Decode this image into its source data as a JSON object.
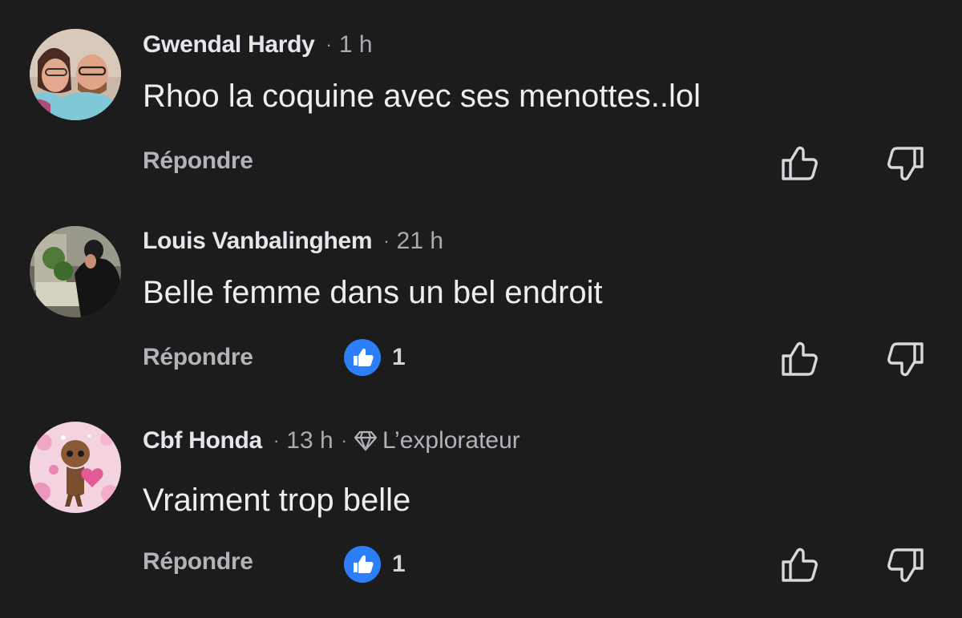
{
  "colors": {
    "background": "#1c1c1d",
    "like_blue": "#2d7ff9",
    "muted_text": "#b0b3b8"
  },
  "comments": [
    {
      "name": "Gwendal Hardy",
      "time": "1 h",
      "text": "Rhoo la coquine avec ses menottes..lol",
      "reply_label": "Répondre",
      "avatar": "couple-photo",
      "upvote_icon": "thumbs-up-outline-icon",
      "downvote_icon": "thumbs-down-outline-icon"
    },
    {
      "name": "Louis Vanbalinghem",
      "time": "21 h",
      "text": "Belle femme dans un bel endroit",
      "reply_label": "Répondre",
      "reaction_icon": "like-reaction-icon",
      "reaction_count": "1",
      "avatar": "man-outdoor-photo",
      "upvote_icon": "thumbs-up-outline-icon",
      "downvote_icon": "thumbs-down-outline-icon"
    },
    {
      "name": "Cbf Honda",
      "time": "13 h",
      "badge_icon": "diamond-icon",
      "badge": "L’explorateur",
      "text": "Vraiment trop belle",
      "reply_label": "Répondre",
      "reaction_icon": "like-reaction-icon",
      "reaction_count": "1",
      "avatar": "pink-illustration",
      "upvote_icon": "thumbs-up-outline-icon",
      "downvote_icon": "thumbs-down-outline-icon"
    }
  ]
}
